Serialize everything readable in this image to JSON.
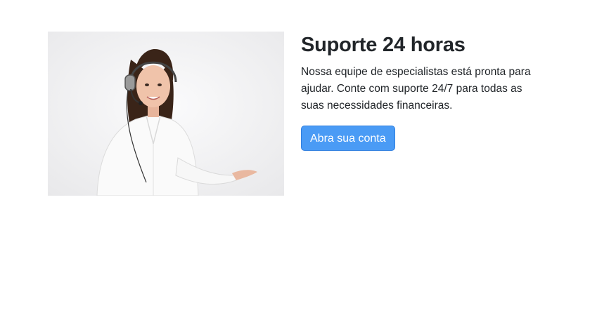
{
  "feature": {
    "title": "Suporte 24 horas",
    "description": "Nossa equipe de especialistas está pronta para ajudar. Conte com suporte 24/7 para todas as suas necessidades financeiras.",
    "cta_label": "Abra sua conta",
    "image_icon": "support-agent-photo"
  },
  "colors": {
    "button_bg": "#4a9bf5",
    "button_border": "#2f7fe0",
    "text": "#212529"
  }
}
